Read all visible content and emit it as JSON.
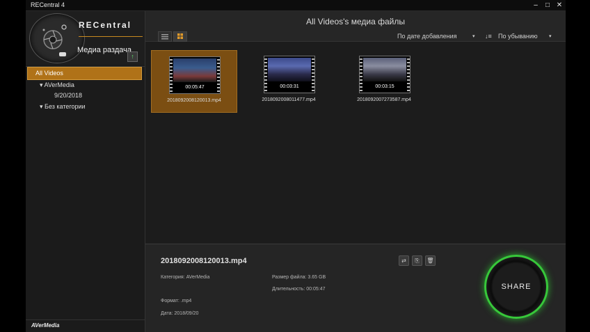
{
  "window": {
    "title": "RECentral 4",
    "minimize": "–",
    "maximize": "□",
    "close": "✕"
  },
  "sidebar": {
    "brand": "RECentral",
    "section_title": "Медиа раздача",
    "upload_icon": "↑",
    "nav": [
      {
        "label": "All Videos"
      },
      {
        "label": "AVerMedia",
        "arrow": "▾"
      },
      {
        "label": "9/20/2018"
      },
      {
        "label": "Без категории",
        "arrow": "▾"
      }
    ],
    "footer_logo": "AVerMedia"
  },
  "main": {
    "title": "All Videos's медиа файлы",
    "sort_by": "По дате добавления",
    "sort_order": "По убыванию",
    "sort_icon": "↓≡",
    "caret": "▾"
  },
  "videos": [
    {
      "filename": "2018092008120013.mp4",
      "duration": "00:05:47",
      "selected": true,
      "scene": "#3a5c8e"
    },
    {
      "filename": "2018092008011477.mp4",
      "duration": "00:03:31",
      "selected": false,
      "scene": "#45508f"
    },
    {
      "filename": "2018092007273587.mp4",
      "duration": "00:03:15",
      "selected": false,
      "scene": "#6b6f86"
    }
  ],
  "details": {
    "filename": "2018092008120013.mp4",
    "category": "Категория: AVerMedia",
    "filesize": "Размер файла: 3.65 GB",
    "duration": "Длительность: 00:05:47",
    "format": "Формат: .mp4",
    "date": "Дата: 2018/09/20",
    "share_label": "SHARE",
    "actions": [
      "⇄",
      "⎘",
      "🗑"
    ]
  },
  "colors": {
    "accent": "#b07218",
    "share_green": "#37c83a"
  }
}
